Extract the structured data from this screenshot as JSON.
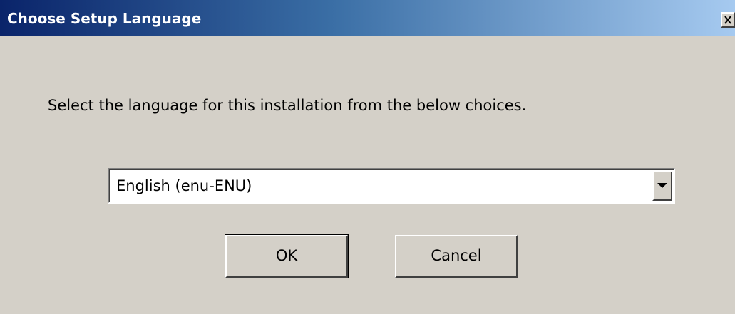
{
  "window": {
    "title": "Choose Setup Language",
    "close_symbol": "✕",
    "close_icon": "close-icon"
  },
  "dialog": {
    "prompt": "Select the language for this installation from the below choices.",
    "language_select": {
      "selected": "English (enu-ENU)",
      "dropdown_icon": "chevron-down-icon"
    },
    "buttons": {
      "ok_label": "OK",
      "cancel_label": "Cancel"
    }
  },
  "colors": {
    "title_gradient_start": "#0a246a",
    "title_gradient_end": "#a6caf0",
    "dialog_background": "#d4d0c8"
  }
}
